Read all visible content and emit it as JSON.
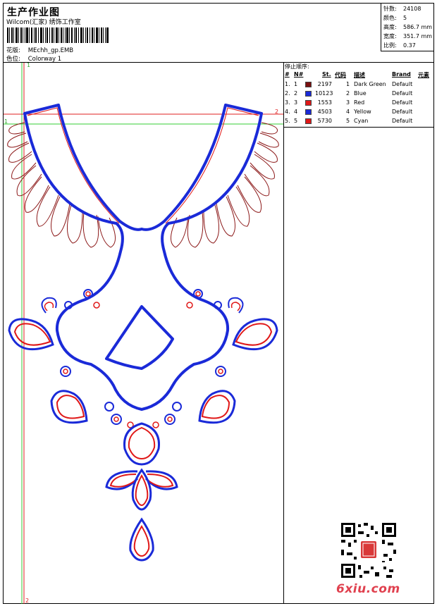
{
  "header": {
    "title": "生产作业图",
    "company": "Wilcom(汇家) 绣饰工作室",
    "design_label": "花版:",
    "design_file": "MEchh_gp.EMB",
    "colorway_label": "色位:",
    "colorway_name": "Colorway 1"
  },
  "stats": [
    {
      "label": "针数:",
      "value": "24108"
    },
    {
      "label": "颜色:",
      "value": "5"
    },
    {
      "label": "高度:",
      "value": "586.7 mm"
    },
    {
      "label": "宽度:",
      "value": "351.7 mm"
    },
    {
      "label": "比例:",
      "value": "0.37"
    }
  ],
  "stop_sequence": {
    "title": "停止顺序:",
    "headers": {
      "idx": "#",
      "n": "N#",
      "st": "St.",
      "code": "代码",
      "desc": "描述",
      "brand": "Brand",
      "elem": "元素"
    },
    "rows": [
      {
        "idx": "1.",
        "n": "1",
        "color": "#7a1010",
        "st": "2197",
        "code": "1",
        "desc": "Dark Green",
        "brand": "Default"
      },
      {
        "idx": "2.",
        "n": "2",
        "color": "#1a2ad8",
        "st": "10123",
        "code": "2",
        "desc": "Blue",
        "brand": "Default"
      },
      {
        "idx": "3.",
        "n": "3",
        "color": "#e01818",
        "st": "1553",
        "code": "3",
        "desc": "Red",
        "brand": "Default"
      },
      {
        "idx": "4.",
        "n": "4",
        "color": "#1a2ad8",
        "st": "4503",
        "code": "4",
        "desc": "Yellow",
        "brand": "Default"
      },
      {
        "idx": "5.",
        "n": "5",
        "color": "#e01818",
        "st": "5730",
        "code": "5",
        "desc": "Cyan",
        "brand": "Default"
      }
    ]
  },
  "guides": {
    "marker_1": "1",
    "marker_2": "2",
    "marker_2_bottom": "2",
    "marker_1_side": "1"
  },
  "watermark": "6xiu.com",
  "colors": {
    "blue": "#1a2ad8",
    "red": "#e01818",
    "dark": "#7a1010",
    "guide_green": "#33cc33",
    "guide_red": "#e02020"
  }
}
